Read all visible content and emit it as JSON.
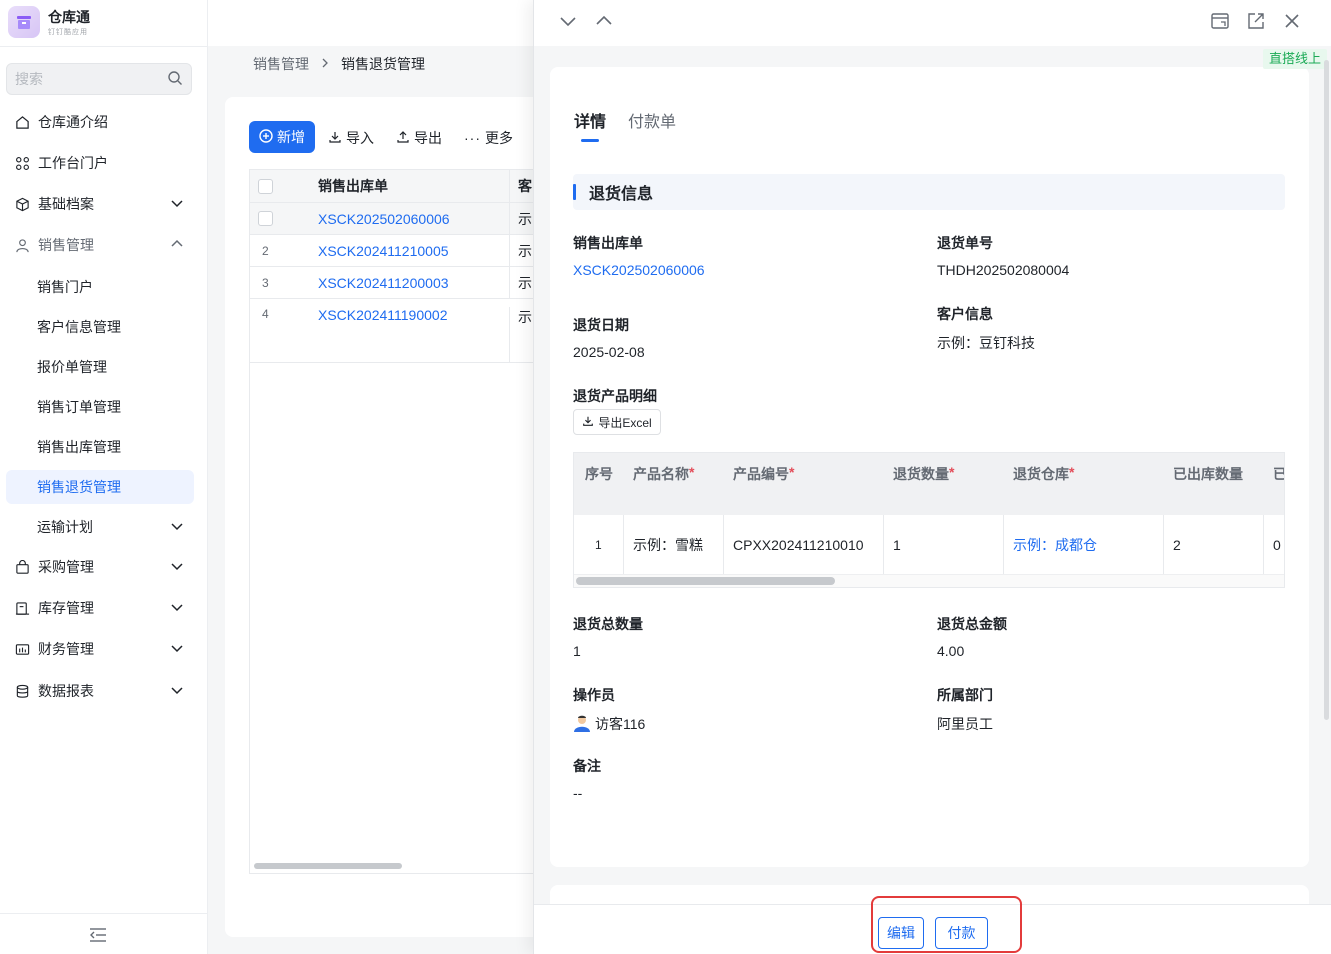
{
  "app": {
    "name": "仓库通",
    "subtitle": "钉钉酷应用"
  },
  "search": {
    "placeholder": "搜索"
  },
  "nav": {
    "items": [
      {
        "label": "仓库通介绍",
        "icon": "home-icon"
      },
      {
        "label": "工作台门户",
        "icon": "grid-icon"
      },
      {
        "label": "基础档案",
        "icon": "cube-icon"
      },
      {
        "label": "销售管理",
        "icon": "user-icon"
      },
      {
        "label": "销售门户"
      },
      {
        "label": "客户信息管理"
      },
      {
        "label": "报价单管理"
      },
      {
        "label": "销售订单管理"
      },
      {
        "label": "销售出库管理"
      },
      {
        "label": "销售退货管理"
      },
      {
        "label": "运输计划"
      },
      {
        "label": "采购管理",
        "icon": "bag-icon"
      },
      {
        "label": "库存管理",
        "icon": "stock-icon"
      },
      {
        "label": "财务管理",
        "icon": "finance-icon"
      },
      {
        "label": "数据报表",
        "icon": "database-icon"
      }
    ]
  },
  "breadcrumb": {
    "parent": "销售管理",
    "current": "销售退货管理"
  },
  "toolbar": {
    "new_label": "新增",
    "import_label": "导入",
    "export_label": "导出",
    "more_label": "更多"
  },
  "list": {
    "headers": {
      "code": "销售出库单",
      "customer": "客"
    },
    "rows": [
      {
        "no": "",
        "code": "XSCK202502060006",
        "customer": "示"
      },
      {
        "no": "2",
        "code": "XSCK202411210005",
        "customer": "示"
      },
      {
        "no": "3",
        "code": "XSCK202411200003",
        "customer": "示"
      },
      {
        "no": "4",
        "code": "XSCK202411190002",
        "customer": "示"
      }
    ]
  },
  "drawer": {
    "live_tag": "直搭线上",
    "tabs": [
      "详情",
      "付款单"
    ],
    "section_title": "退货信息",
    "fields": {
      "sales_out_label": "销售出库单",
      "sales_out_value": "XSCK202502060006",
      "return_no_label": "退货单号",
      "return_no_value": "THDH202502080004",
      "customer_label": "客户信息",
      "customer_value": "示例：豆钉科技",
      "return_date_label": "退货日期",
      "return_date_value": "2025-02-08",
      "detail_label": "退货产品明细",
      "total_qty_label": "退货总数量",
      "total_qty_value": "1",
      "total_amount_label": "退货总金额",
      "total_amount_value": "4.00",
      "operator_label": "操作员",
      "operator_value": "访客116",
      "department_label": "所属部门",
      "department_value": "阿里员工",
      "remark_label": "备注",
      "remark_value": "--"
    },
    "export_excel_label": "导出Excel",
    "product_table": {
      "headers": [
        "序号",
        "产品名称",
        "产品编号",
        "退货数量",
        "退货仓库",
        "已出库数量",
        "已"
      ],
      "row": [
        "1",
        "示例：雪糕",
        "CPXX202411210010",
        "1",
        "示例：成都仓",
        "2",
        "0"
      ]
    },
    "footer": {
      "edit_label": "编辑",
      "pay_label": "付款"
    }
  }
}
